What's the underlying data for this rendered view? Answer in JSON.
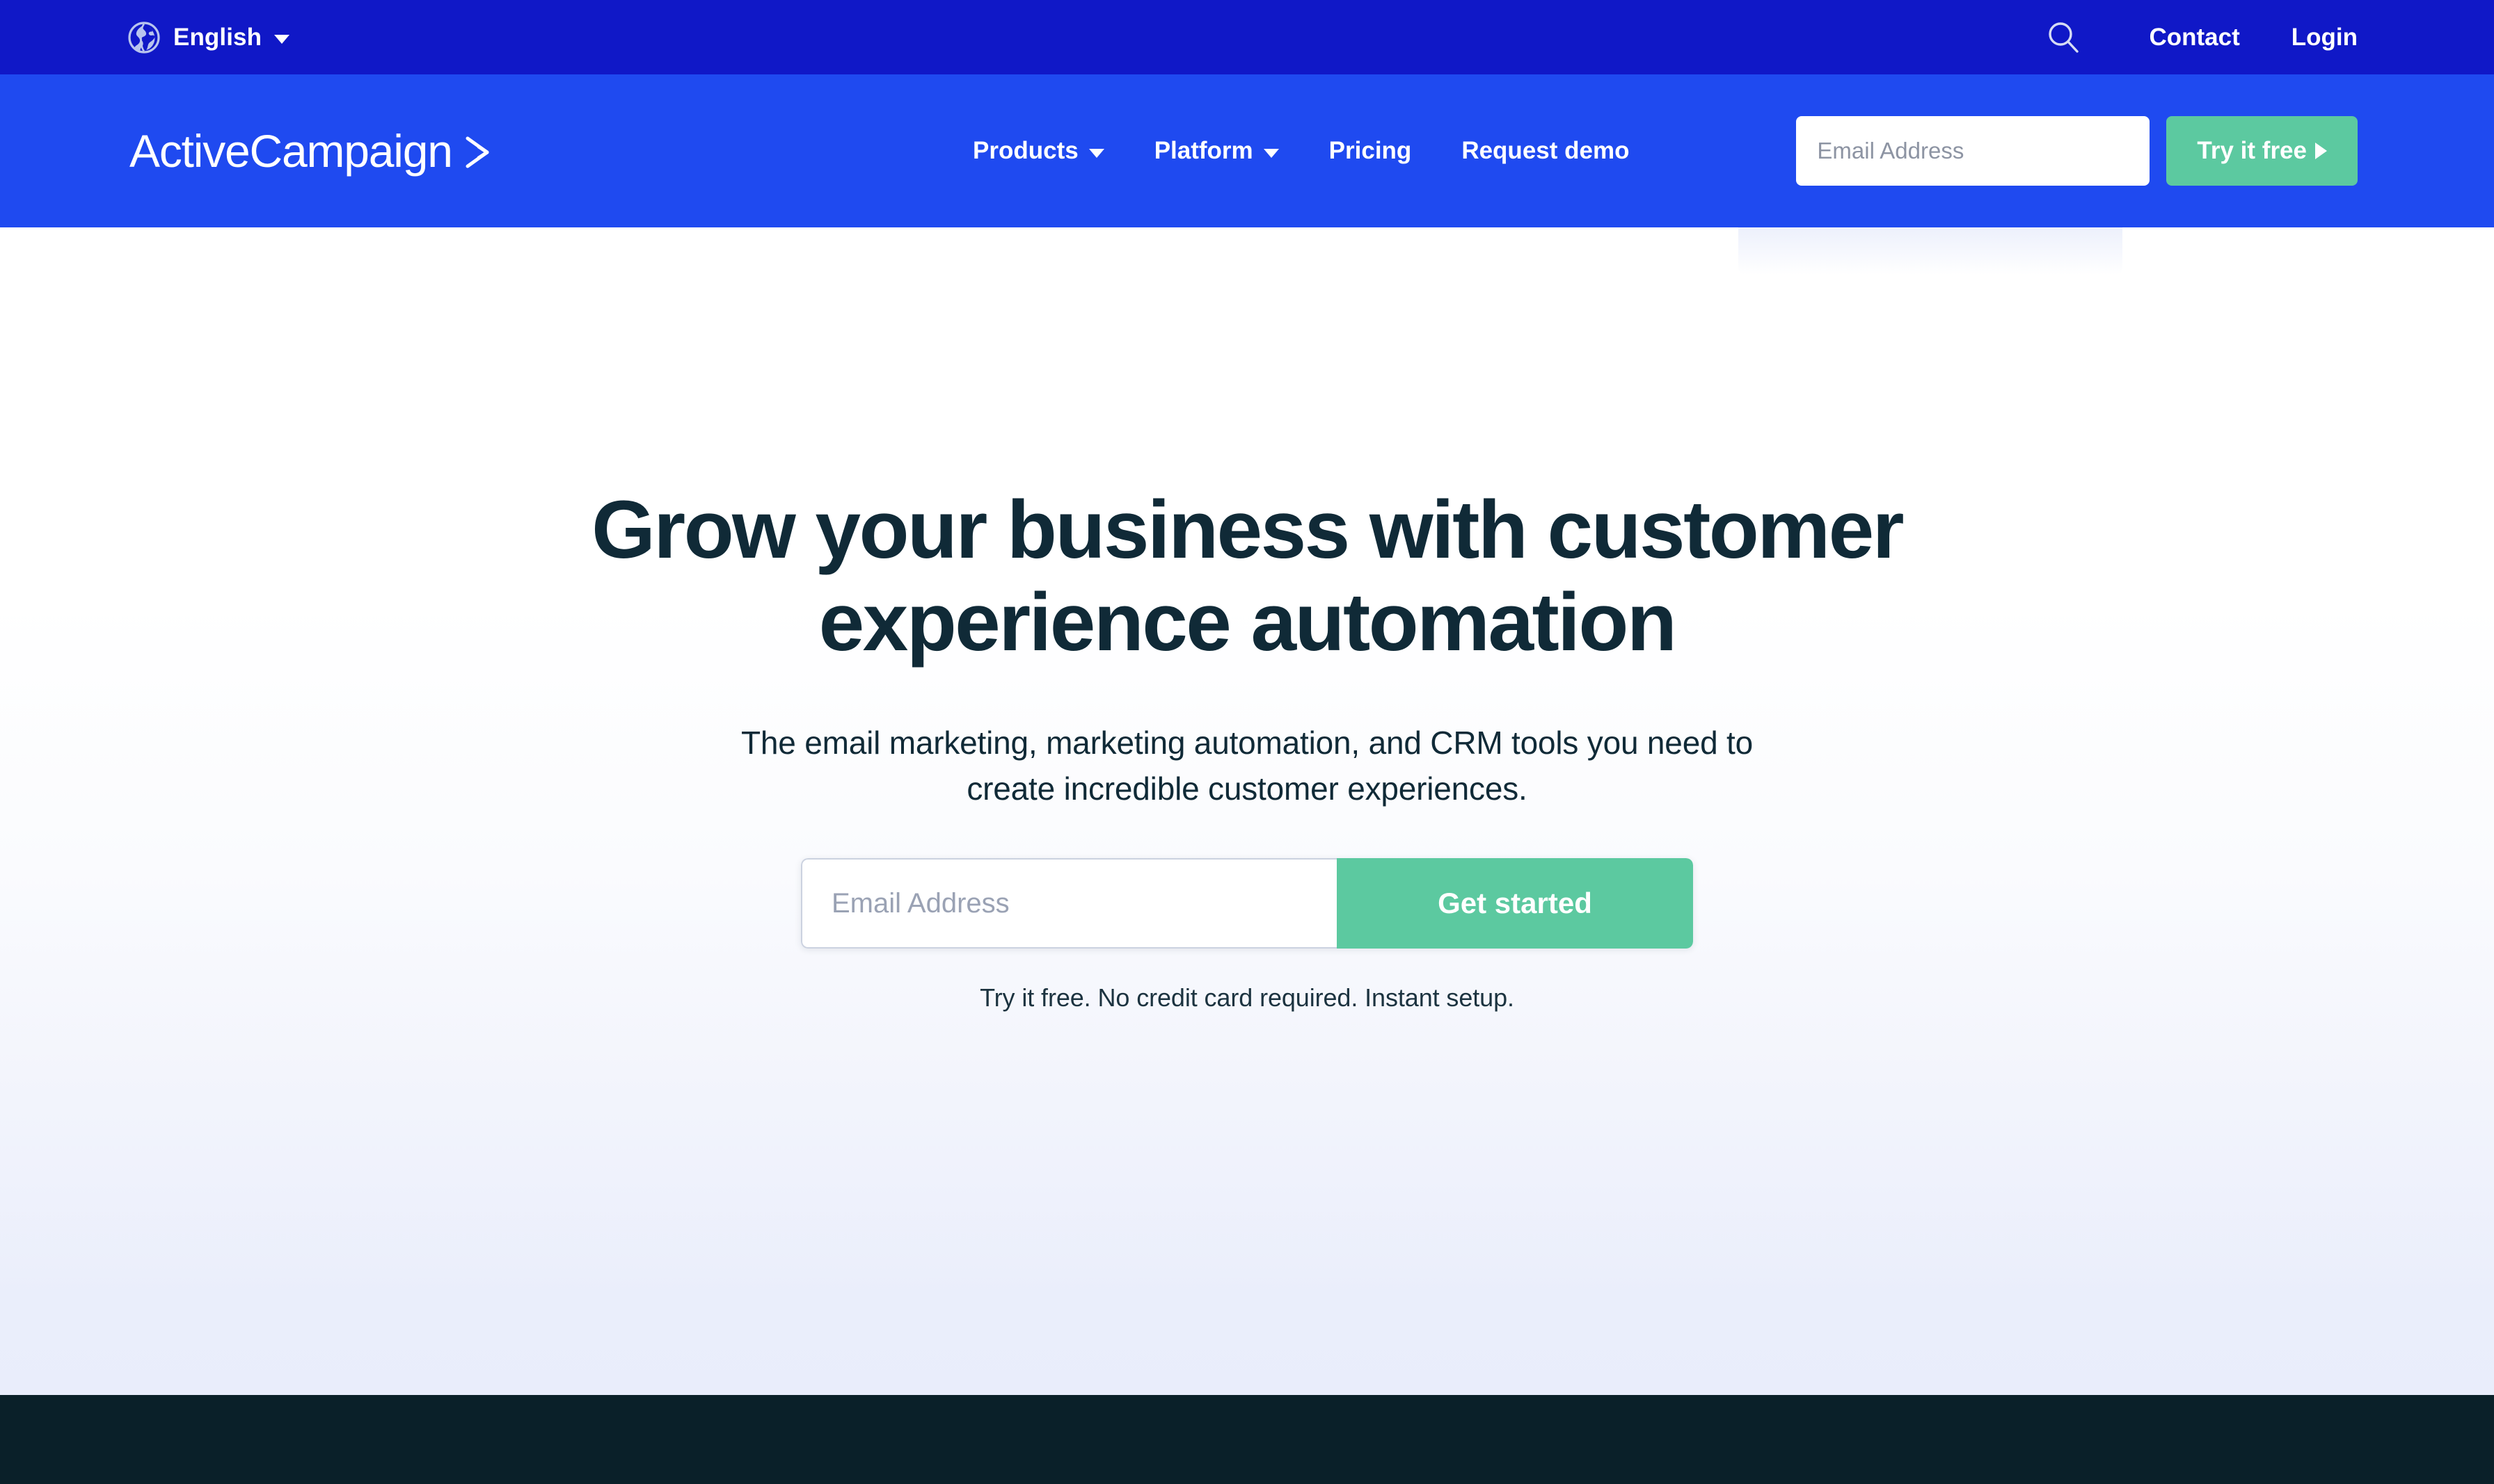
{
  "colors": {
    "topbar_blue": "#1018C7",
    "nav_blue": "#1F4AF0",
    "accent_green": "#5CC9A0",
    "heading_navy": "#102A37",
    "footer_navy": "#0A2029",
    "hero_gradient_end": "#E9EDFB"
  },
  "topbar": {
    "language": "English",
    "globe_icon": "globe-icon",
    "caret_icon": "chevron-down-icon",
    "search_icon": "search-icon",
    "contact_label": "Contact",
    "login_label": "Login"
  },
  "nav": {
    "logo_text": "ActiveCampaign",
    "logo_mark": "chevron-right-mark",
    "items": [
      {
        "label": "Products",
        "has_dropdown": true
      },
      {
        "label": "Platform",
        "has_dropdown": true
      },
      {
        "label": "Pricing",
        "has_dropdown": false
      },
      {
        "label": "Request demo",
        "has_dropdown": false
      }
    ],
    "email_placeholder": "Email Address",
    "email_value": "",
    "cta_label": "Try it free",
    "cta_arrow_icon": "play-triangle-icon"
  },
  "hero": {
    "title_line1": "Grow your business with customer",
    "title_line2": "experience automation",
    "subtitle_line1": "The email marketing, marketing automation, and CRM tools you need to",
    "subtitle_line2": "create incredible customer experiences.",
    "email_placeholder": "Email Address",
    "email_value": "",
    "submit_label": "Get started",
    "note": "Try it free. No credit card required. Instant setup."
  }
}
